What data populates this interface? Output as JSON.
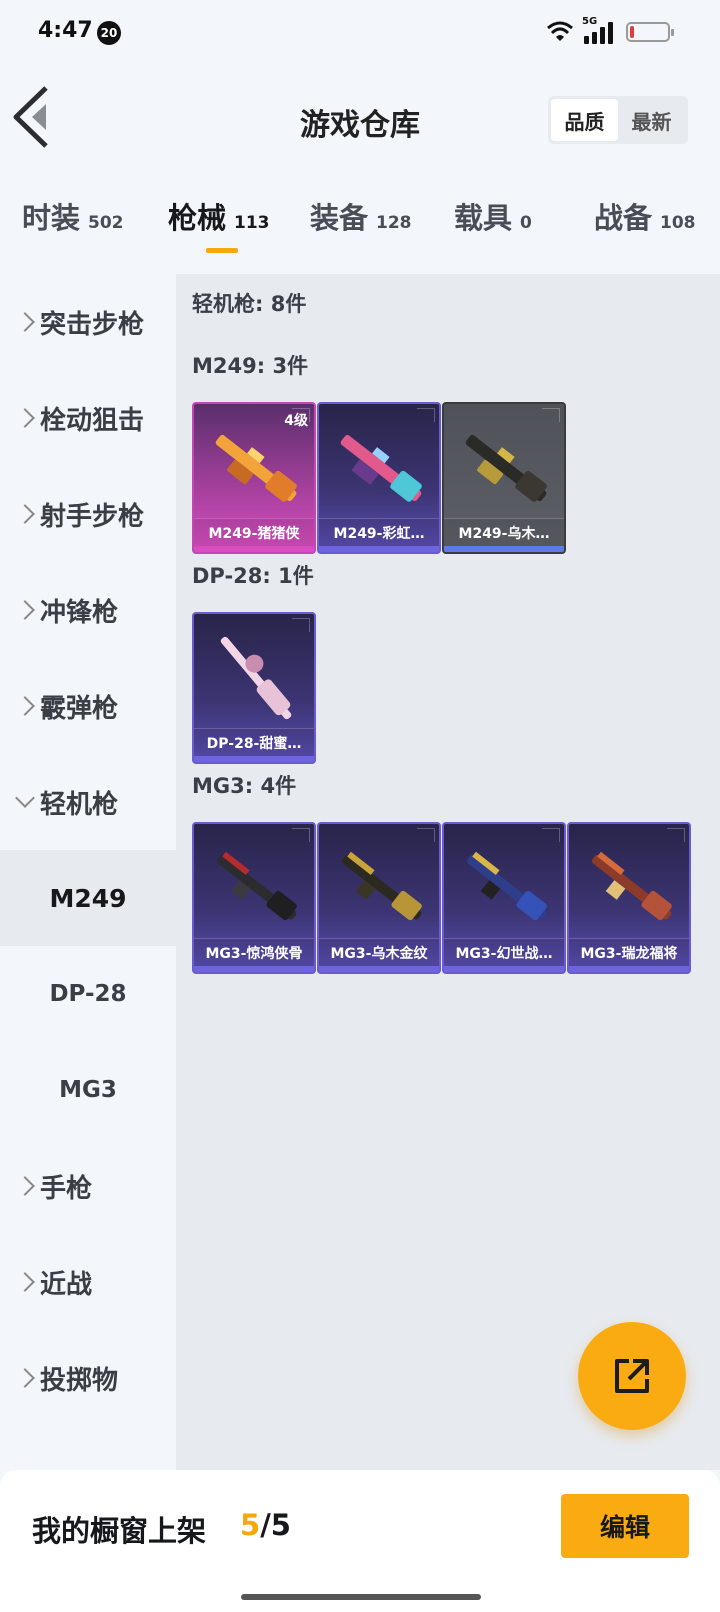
{
  "status_bar": {
    "time": "4:47",
    "badge": "20",
    "network": "5G"
  },
  "header": {
    "title": "游戏仓库",
    "sort_options": [
      {
        "label": "品质",
        "active": true
      },
      {
        "label": "最新",
        "active": false
      }
    ]
  },
  "tabs": [
    {
      "label": "时装",
      "count": "502",
      "active": false
    },
    {
      "label": "枪械",
      "count": "113",
      "active": true
    },
    {
      "label": "装备",
      "count": "128",
      "active": false
    },
    {
      "label": "载具",
      "count": "0",
      "active": false
    },
    {
      "label": "战备",
      "count": "108",
      "active": false
    }
  ],
  "sidebar": {
    "items": [
      {
        "label": "突击步枪"
      },
      {
        "label": "栓动狙击"
      },
      {
        "label": "射手步枪"
      },
      {
        "label": "冲锋枪"
      },
      {
        "label": "霰弹枪"
      },
      {
        "label": "轻机枪",
        "expanded": true
      },
      {
        "label": "手枪"
      },
      {
        "label": "近战"
      },
      {
        "label": "投掷物"
      }
    ],
    "subitems": [
      {
        "label": "M249",
        "active": true
      },
      {
        "label": "DP-28",
        "active": false
      },
      {
        "label": "MG3",
        "active": false
      }
    ]
  },
  "content": {
    "category_title": "轻机枪: 8件",
    "groups": [
      {
        "title": "M249: 3件",
        "items": [
          {
            "name": "M249-猪猪侠",
            "level": "4级",
            "rarity": "pink"
          },
          {
            "name": "M249-彩虹…",
            "level": "",
            "rarity": "purple"
          },
          {
            "name": "M249-乌木…",
            "level": "",
            "rarity": "grey"
          }
        ]
      },
      {
        "title": "DP-28: 1件",
        "items": [
          {
            "name": "DP-28-甜蜜…",
            "level": "",
            "rarity": "purple"
          }
        ]
      },
      {
        "title": "MG3: 4件",
        "items": [
          {
            "name": "MG3-惊鸿侠骨",
            "level": "",
            "rarity": "purple"
          },
          {
            "name": "MG3-乌木金纹",
            "level": "",
            "rarity": "purple"
          },
          {
            "name": "MG3-幻世战…",
            "level": "",
            "rarity": "purple"
          },
          {
            "name": "MG3-瑞龙福将",
            "level": "",
            "rarity": "purple"
          }
        ]
      }
    ]
  },
  "bottom_bar": {
    "label": "我的橱窗上架",
    "count_current": "5",
    "count_total": "/5",
    "edit_label": "编辑"
  },
  "colors": {
    "accent": "#fbab12",
    "pink_rarity": "#c845b9",
    "purple_rarity": "#6a5bd0"
  },
  "icons": [
    "back-icon",
    "share-export-icon",
    "wifi-icon",
    "signal-icon",
    "battery-icon",
    "chevron-right-icon",
    "chevron-down-icon"
  ]
}
